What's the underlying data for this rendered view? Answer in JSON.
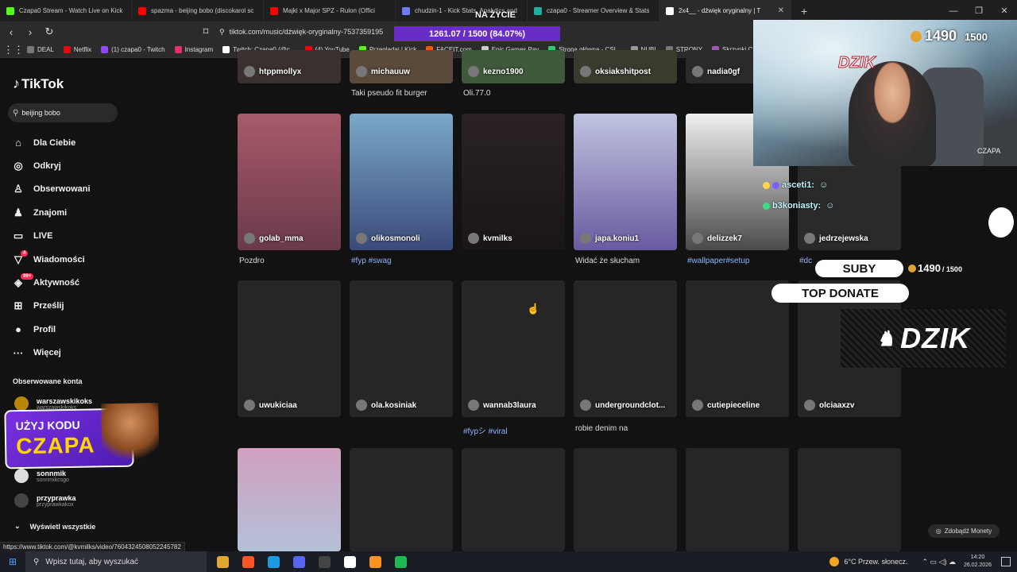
{
  "browser": {
    "tabs": [
      {
        "title": "Czapa0 Stream - Watch Live on Kick",
        "color": "#53fc18"
      },
      {
        "title": "spazma - beijing bobo (discokarol sc",
        "color": "#ff0000"
      },
      {
        "title": "Majki x Major SPZ - Rulon (Offici",
        "color": "#ff0000"
      },
      {
        "title": "chudzin-1 - Kick Stats, Analytics and",
        "color": "#6c7cff"
      },
      {
        "title": "czapa0 - Streamer Overview & Stats",
        "color": "#1bb19c"
      },
      {
        "title": "2x4__ - dźwięk oryginalny | T",
        "color": "#ffffff",
        "active": true
      }
    ],
    "new_tab": "+",
    "url": "tiktok.com/music/dźwięk-oryginalny-7537359195",
    "bookmarks": [
      {
        "label": "DEAL",
        "color": "#777777"
      },
      {
        "label": "Netflix",
        "color": "#e50914"
      },
      {
        "label": "(1) czapa0 - Twitch",
        "color": "#9146ff"
      },
      {
        "label": "Instagram",
        "color": "#e1306c"
      },
      {
        "label": "Twitch: Czapa0 (@c...",
        "color": "#ffffff"
      },
      {
        "label": "(4) YouTube",
        "color": "#ff0000"
      },
      {
        "label": "Przeglądaj | Kick",
        "color": "#53fc18"
      },
      {
        "label": "FACEIT.com",
        "color": "#ff5500"
      },
      {
        "label": "Epic Games Pay",
        "color": "#cccccc"
      },
      {
        "label": "Strona główna - CSI...",
        "color": "#2ecc71"
      },
      {
        "label": "NUBI",
        "color": "#999999"
      },
      {
        "label": "STRONY",
        "color": "#777777"
      },
      {
        "label": "Skrzynki CSr",
        "color": "#9b59b6"
      }
    ]
  },
  "sidebar": {
    "logo": "TikTok",
    "search_value": "beijing bobo",
    "nav": [
      {
        "label": "Dla Ciebie",
        "icon": "home-icon",
        "glyph": "⌂"
      },
      {
        "label": "Odkryj",
        "icon": "compass-icon",
        "glyph": "◎"
      },
      {
        "label": "Obserwowani",
        "icon": "following-icon",
        "glyph": "♙"
      },
      {
        "label": "Znajomi",
        "icon": "friends-icon",
        "glyph": "♟"
      },
      {
        "label": "LIVE",
        "icon": "live-icon",
        "glyph": "▭"
      },
      {
        "label": "Wiadomości",
        "icon": "messages-icon",
        "glyph": "▽",
        "badge": "4"
      },
      {
        "label": "Aktywność",
        "icon": "activity-icon",
        "glyph": "◈",
        "badge": "99+"
      },
      {
        "label": "Prześlij",
        "icon": "upload-icon",
        "glyph": "⊞"
      },
      {
        "label": "Profil",
        "icon": "profile-icon",
        "glyph": "●"
      },
      {
        "label": "Więcej",
        "icon": "more-icon",
        "glyph": "···"
      }
    ],
    "following_title": "Obserwowane konta",
    "accounts": [
      {
        "name": "warszawskikoks",
        "handle": "warszawskikoks"
      },
      {
        "name": "sonnmik",
        "handle": "sonnmikcsgo"
      },
      {
        "name": "przyprawka",
        "handle": "przyprawkakox"
      }
    ],
    "show_all": "Wyświetl wszystkie",
    "promo": {
      "line1": "UŻYJ KODU",
      "line2": "CZAPA"
    }
  },
  "grid": {
    "row0": [
      {
        "owner": "htppmollyx",
        "caption": ""
      },
      {
        "owner": "michauuw",
        "caption": "Taki pseudo fit burger"
      },
      {
        "owner": "kezno1900",
        "caption": "Oli.77.0"
      },
      {
        "owner": "oksiakshitpost",
        "caption": ""
      },
      {
        "owner": "nadia0gf",
        "caption": ""
      }
    ],
    "row1": [
      {
        "owner": "golab_mma",
        "caption": "Pozdro",
        "tag": false
      },
      {
        "owner": "olikosmonoli",
        "caption": "#fyp #swag",
        "tag": true
      },
      {
        "owner": "kvmilks",
        "caption": "",
        "tag": false
      },
      {
        "owner": "japa.koniu1",
        "caption": "Widać że słucham",
        "tag": false
      },
      {
        "owner": "delizzek7",
        "caption": "#wallpaper#setup",
        "tag": true
      },
      {
        "owner": "jedrzejewska",
        "caption": "#dc",
        "tag": true
      }
    ],
    "row2": [
      {
        "owner": "uwukiciaa",
        "caption": "",
        "tag": false
      },
      {
        "owner": "ola.kosiniak",
        "caption": "",
        "tag": false
      },
      {
        "owner": "wannab3laura",
        "caption": "#fypシ #viral",
        "tag": true
      },
      {
        "owner": "undergroundclot...",
        "caption": "robie denim na",
        "tag": false
      },
      {
        "owner": "cutiepieceline",
        "caption": "",
        "tag": false
      },
      {
        "owner": "olciaaxzv",
        "caption": "",
        "tag": false
      }
    ]
  },
  "overlay": {
    "live_label": "NA ŻYCIE",
    "goal": "1261.07 / 1500 (84.07%)",
    "goal_fraction": 0.8407,
    "cam_count": "1490",
    "cam_goal": "1500",
    "cam_logo": "DZIK",
    "cam_corner": "CZAPA",
    "chat": [
      {
        "user": "asceti1:",
        "color": "#ffd54a"
      },
      {
        "user": "b3koniasty:",
        "color": "#3ddc84"
      }
    ],
    "suby_label": "SUBY",
    "suby_count": "1490",
    "suby_goal": "/ 1500",
    "top_donate": "TOP DONATE",
    "dzik_banner": "DZIK",
    "zdobadz": "Zdobądź Monety"
  },
  "status_url": "https://www.tiktok.com/@kvmilks/video/7604324508052245782",
  "taskbar": {
    "search_placeholder": "Wpisz tutaj, aby wyszukać",
    "apps": [
      "#e0a82e",
      "#fb542b",
      "#1b9ae0",
      "#5865f2",
      "#444444",
      "#ffffff",
      "#f7931e",
      "#1db954"
    ],
    "weather": "6°C  Przew. słonecz.",
    "time": "14:20",
    "date": "26.02.2026"
  }
}
